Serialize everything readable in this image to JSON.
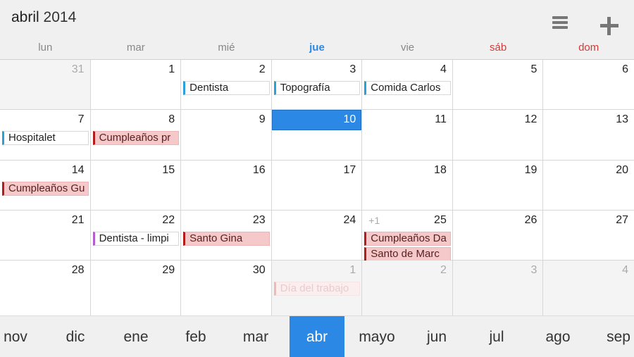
{
  "header": {
    "month": "abril",
    "year": "2014"
  },
  "weekdays": [
    "lun",
    "mar",
    "mié",
    "jue",
    "vie",
    "sáb",
    "dom"
  ],
  "calendar": {
    "weeks": [
      {
        "days": [
          {
            "num": "31",
            "other": true
          },
          {
            "num": "1"
          },
          {
            "num": "2",
            "events": [
              {
                "label": "Dentista",
                "color": "blue"
              }
            ]
          },
          {
            "num": "3",
            "events": [
              {
                "label": "Topografía",
                "color": "blue"
              }
            ]
          },
          {
            "num": "4",
            "events": [
              {
                "label": "Comida Carlos",
                "color": "blue"
              }
            ]
          },
          {
            "num": "5"
          },
          {
            "num": "6"
          }
        ]
      },
      {
        "days": [
          {
            "num": "7",
            "events": [
              {
                "label": "Hospitalet",
                "color": "blue"
              }
            ]
          },
          {
            "num": "8",
            "events": [
              {
                "label": "Cumpleaños pr",
                "color": "red"
              }
            ]
          },
          {
            "num": "9"
          },
          {
            "num": "10",
            "today": true
          },
          {
            "num": "11"
          },
          {
            "num": "12"
          },
          {
            "num": "13"
          }
        ]
      },
      {
        "days": [
          {
            "num": "14",
            "events": [
              {
                "label": "Cumpleaños Gu",
                "color": "red"
              }
            ]
          },
          {
            "num": "15"
          },
          {
            "num": "16"
          },
          {
            "num": "17"
          },
          {
            "num": "18"
          },
          {
            "num": "19"
          },
          {
            "num": "20"
          }
        ]
      },
      {
        "days": [
          {
            "num": "21"
          },
          {
            "num": "22",
            "events": [
              {
                "label": "Dentista - limpi",
                "color": "purple"
              }
            ]
          },
          {
            "num": "23",
            "events": [
              {
                "label": "Santo Gina",
                "color": "red"
              }
            ]
          },
          {
            "num": "24"
          },
          {
            "num": "25",
            "more": "+1",
            "events": [
              {
                "label": "Cumpleaños Da",
                "color": "red"
              },
              {
                "label": "Santo de Marc",
                "color": "red"
              }
            ]
          },
          {
            "num": "26"
          },
          {
            "num": "27"
          }
        ]
      },
      {
        "days": [
          {
            "num": "28"
          },
          {
            "num": "29"
          },
          {
            "num": "30"
          },
          {
            "num": "1",
            "other": true,
            "events": [
              {
                "label": "Día del trabajo",
                "color": "faded"
              }
            ]
          },
          {
            "num": "2",
            "other": true
          },
          {
            "num": "3",
            "other": true
          },
          {
            "num": "4",
            "other": true
          }
        ]
      }
    ]
  },
  "months": [
    "nov",
    "dic",
    "ene",
    "feb",
    "mar",
    "abr",
    "mayo",
    "jun",
    "jul",
    "ago",
    "sep"
  ],
  "active_month": "abr",
  "colors": {
    "accent": "#2b88e5",
    "weekend": "#d23a3a",
    "event_blue": "#2aa0d8",
    "event_red": "#b21c1c",
    "event_purple": "#b55ccc"
  }
}
